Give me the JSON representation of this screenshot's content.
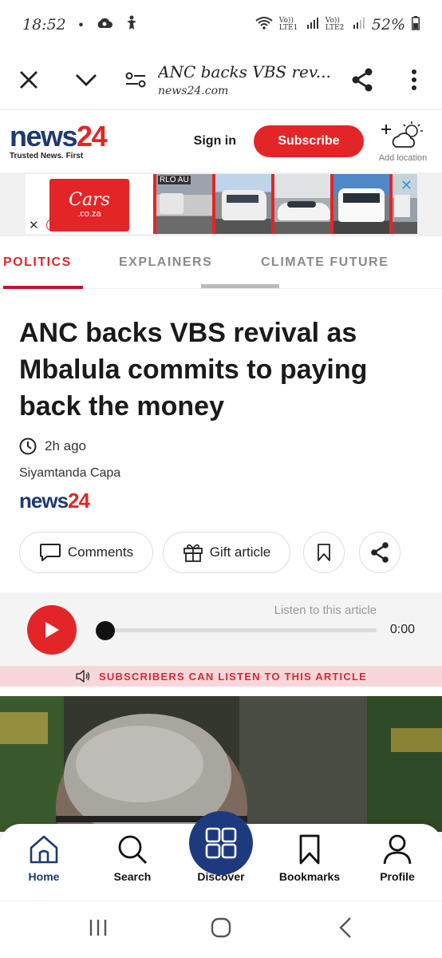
{
  "status_bar": {
    "time": "18:52",
    "dot": "•",
    "network_label_1": "Vo)) LTE1",
    "network_label_2": "Vo)) LTE2",
    "battery": "52%"
  },
  "browser": {
    "title": "ANC backs VBS rev...",
    "url": "news24.com"
  },
  "header": {
    "logo_news": "news",
    "logo_24": "24",
    "tagline": "Trusted News. First",
    "signin": "Sign in",
    "subscribe": "Subscribe",
    "add_location": "Add location"
  },
  "ad": {
    "logo_line1": "Cars",
    "logo_line2": ".co.za",
    "photo_caption": "RLO AU"
  },
  "tabs": [
    {
      "label": "POLITICS"
    },
    {
      "label": "EXPLAINERS"
    },
    {
      "label": "CLIMATE FUTURE"
    }
  ],
  "article": {
    "headline": "ANC backs VBS revival as Mbalula commits to paying back the money",
    "time": "2h ago",
    "author": "Siyamtanda Capa",
    "brand_news": "news",
    "brand_24": "24"
  },
  "actions": {
    "comments": "Comments",
    "gift": "Gift article"
  },
  "player": {
    "listen_label": "Listen to this article",
    "time": "0:00"
  },
  "subscriber_banner": "SUBSCRIBERS CAN LISTEN TO THIS ARTICLE",
  "bottom_nav": [
    {
      "label": "Home"
    },
    {
      "label": "Search"
    },
    {
      "label": "Discover"
    },
    {
      "label": "Bookmarks"
    },
    {
      "label": "Profile"
    }
  ],
  "colors": {
    "brand_red": "#e42527",
    "brand_navy": "#1e3a6e"
  }
}
